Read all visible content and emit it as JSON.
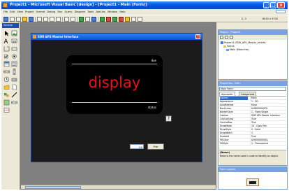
{
  "window": {
    "title": "Project1 - Microsoft Visual Basic [design] - [Project1 - Main (Form)]",
    "controls": {
      "minimize": "_",
      "maximize": "□",
      "close": "×"
    }
  },
  "menu": [
    "File",
    "Edit",
    "View",
    "Project",
    "Format",
    "Debug",
    "Run",
    "Query",
    "Diagram",
    "Tools",
    "Add-Ins",
    "Window",
    "Help"
  ],
  "toolbar": {
    "position": "0, 0",
    "size": "6615 x 5700"
  },
  "toolbox": {
    "title": "General"
  },
  "form": {
    "title": "SDR APS Master Interface",
    "close_glyph": "×",
    "due_label": "due",
    "display_text": "display",
    "status_label": "status",
    "help_glyph": "?",
    "value": "50",
    "fire_label": "Fire"
  },
  "project_explorer": {
    "title": "Project - Project1",
    "root": "Project1 (SDR_APS_Master_Interfa",
    "folder": "Forms",
    "item": "Main (Main.frm)"
  },
  "properties": {
    "title": "Properties - Main",
    "object": "Main Form",
    "tabs": [
      "Alphabetic",
      "Categorized"
    ],
    "rows": [
      {
        "name": "(Name)",
        "value": "Main"
      },
      {
        "name": "Appearance",
        "value": "1 - 3D"
      },
      {
        "name": "AutoRedraw",
        "value": "False"
      },
      {
        "name": "BackColor",
        "value": "&H8000000F&"
      },
      {
        "name": "BorderStyle",
        "value": "1 - Fixed Single"
      },
      {
        "name": "Caption",
        "value": "SDR APS Master Interface"
      },
      {
        "name": "ClipControls",
        "value": "True"
      },
      {
        "name": "ControlBox",
        "value": "True"
      },
      {
        "name": "DrawMode",
        "value": "13 - Copy Pen"
      },
      {
        "name": "DrawStyle",
        "value": "0 - Solid"
      },
      {
        "name": "DrawWidth",
        "value": "1"
      },
      {
        "name": "Enabled",
        "value": "True"
      },
      {
        "name": "FillColor",
        "value": "&H00000000&"
      },
      {
        "name": "FillStyle",
        "value": "1 - Transparent"
      }
    ],
    "desc_title": "(Name)",
    "desc_text": "Returns the name used in code to identify an object."
  },
  "form_layout": {
    "title": "Form Layout"
  },
  "colors": {
    "display_red": "#e8131b",
    "title_blue": "#0a5fe6",
    "form_background": "#1b1b1b"
  }
}
